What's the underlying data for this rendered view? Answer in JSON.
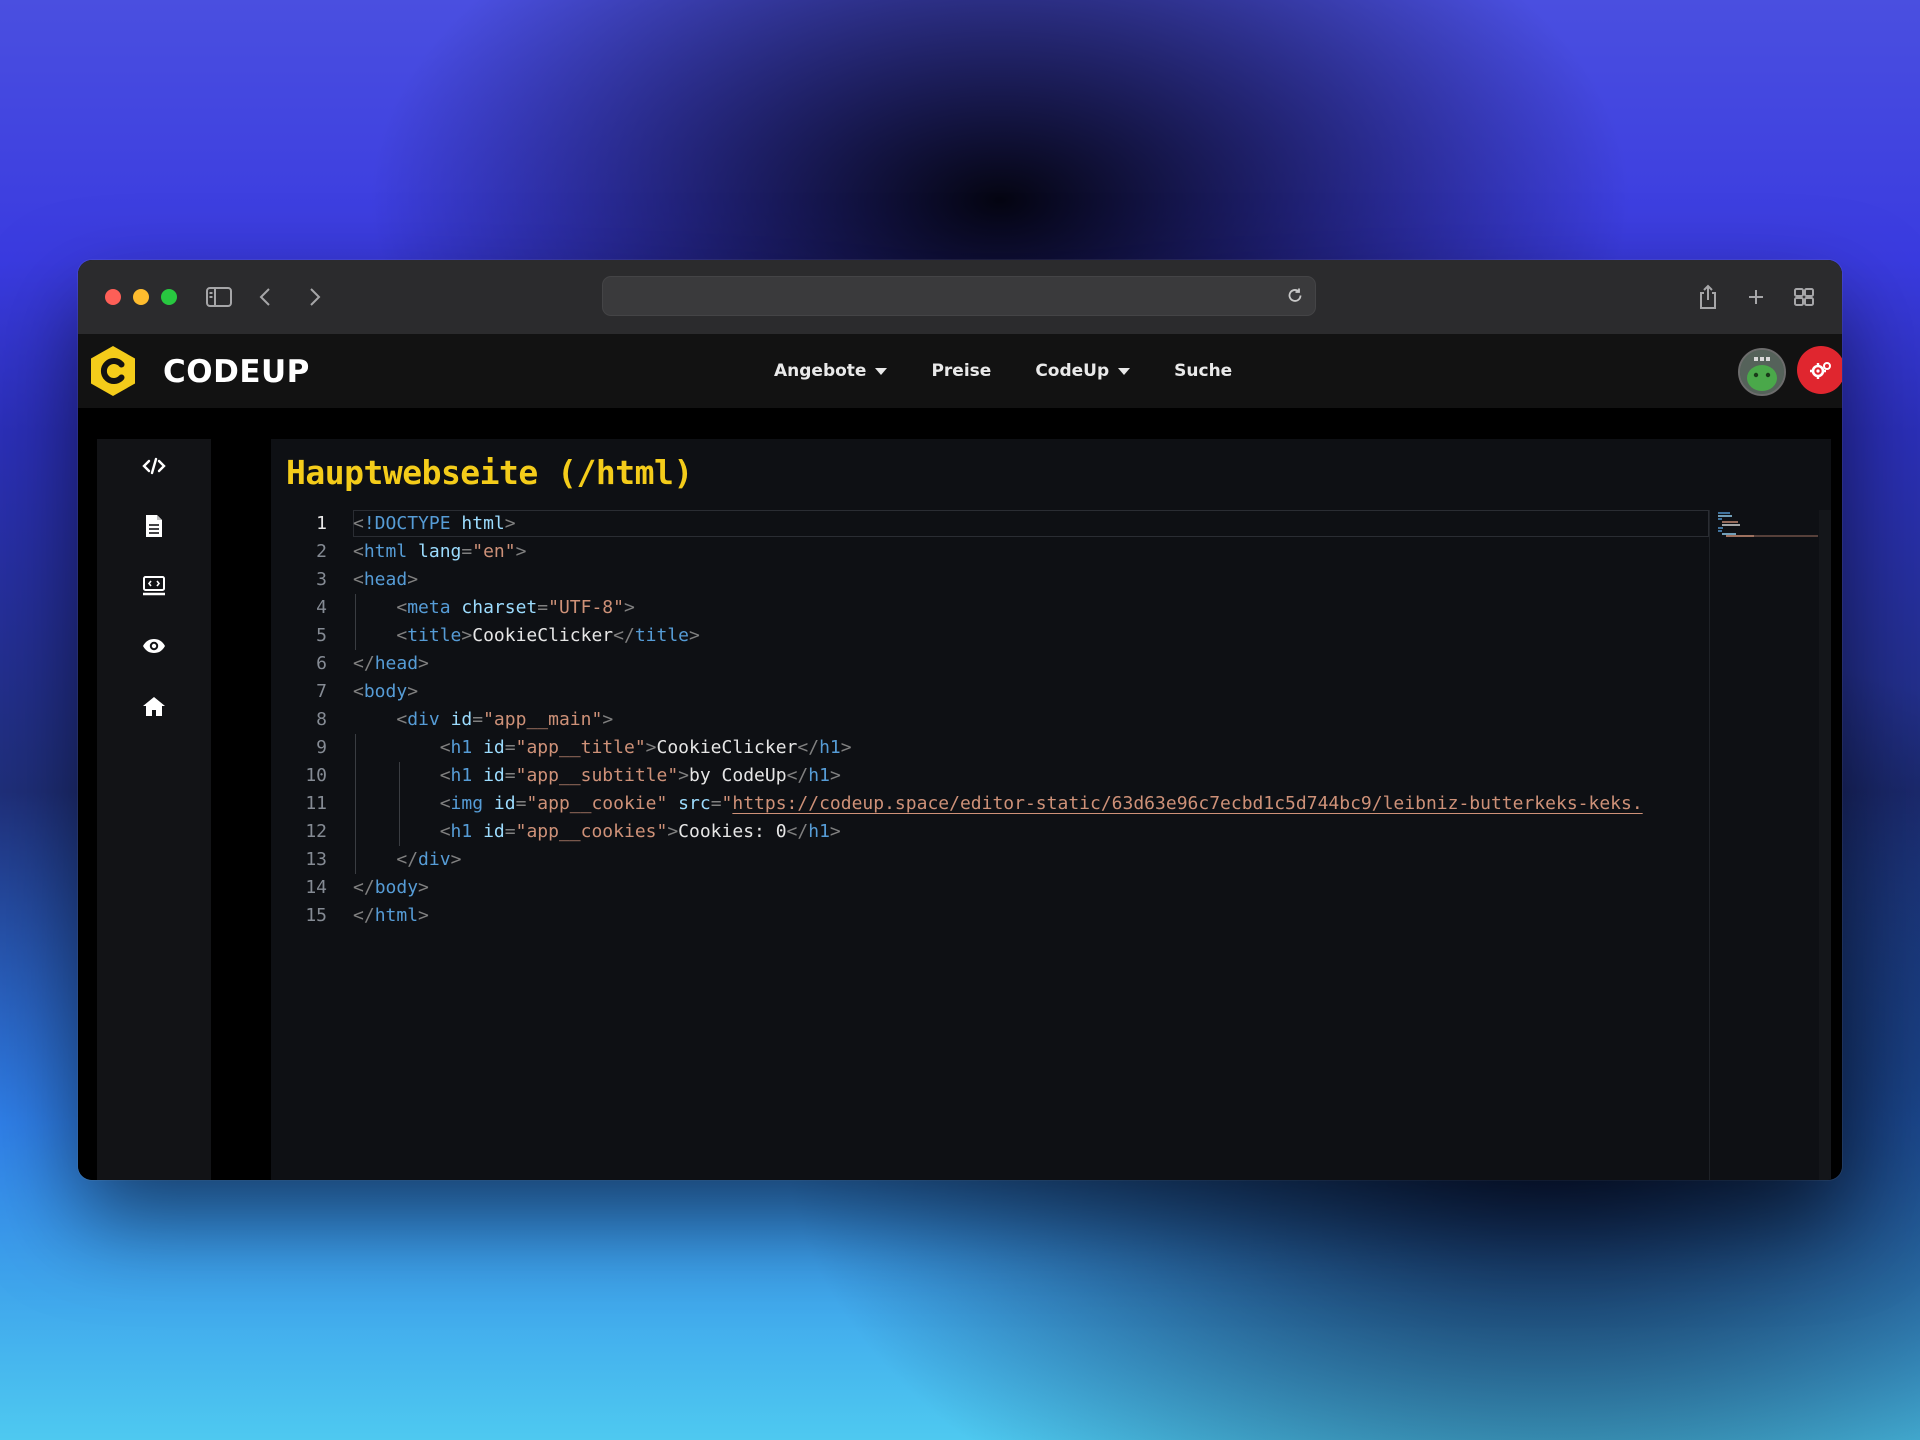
{
  "browser": {
    "url_value": "",
    "icons": [
      "sidebar-icon",
      "back-icon",
      "forward-icon",
      "reload-icon",
      "share-icon",
      "new-tab-icon",
      "tab-overview-icon"
    ]
  },
  "app": {
    "brand": "CODEUP",
    "nav": [
      {
        "label": "Angebote",
        "dropdown": true
      },
      {
        "label": "Preise",
        "dropdown": false
      },
      {
        "label": "CodeUp",
        "dropdown": true
      },
      {
        "label": "Suche",
        "dropdown": false
      }
    ],
    "colors": {
      "brand_yellow": "#f4cc1a",
      "settings_red": "#e0262f"
    }
  },
  "sidebar": {
    "items": [
      "code-icon",
      "file-icon",
      "monitor-code-icon",
      "eye-icon",
      "home-icon"
    ]
  },
  "editor": {
    "title": "Hauptwebseite (/html)",
    "active_line": 1,
    "lines": [
      {
        "n": "1",
        "text": "<!DOCTYPE html>"
      },
      {
        "n": "2",
        "text": "<html lang=\"en\">"
      },
      {
        "n": "3",
        "text": "<head>"
      },
      {
        "n": "4",
        "text": "    <meta charset=\"UTF-8\">"
      },
      {
        "n": "5",
        "text": "    <title>CookieClicker</title>"
      },
      {
        "n": "6",
        "text": "</head>"
      },
      {
        "n": "7",
        "text": "<body>"
      },
      {
        "n": "8",
        "text": "    <div id=\"app__main\">"
      },
      {
        "n": "9",
        "text": "        <h1 id=\"app__title\">CookieClicker</h1>"
      },
      {
        "n": "10",
        "text": "        <h1 id=\"app__subtitle\">by CodeUp</h1>"
      },
      {
        "n": "11",
        "text": "        <img id=\"app__cookie\" src=\"https://codeup.space/editor-static/63d63e96c7ecbd1c5d744bc9/leibniz-butterkeks-keks."
      },
      {
        "n": "12",
        "text": "        <h1 id=\"app__cookies\">Cookies: 0</h1>"
      },
      {
        "n": "13",
        "text": "    </div>"
      },
      {
        "n": "14",
        "text": "</body>"
      },
      {
        "n": "15",
        "text": "</html>"
      }
    ]
  }
}
